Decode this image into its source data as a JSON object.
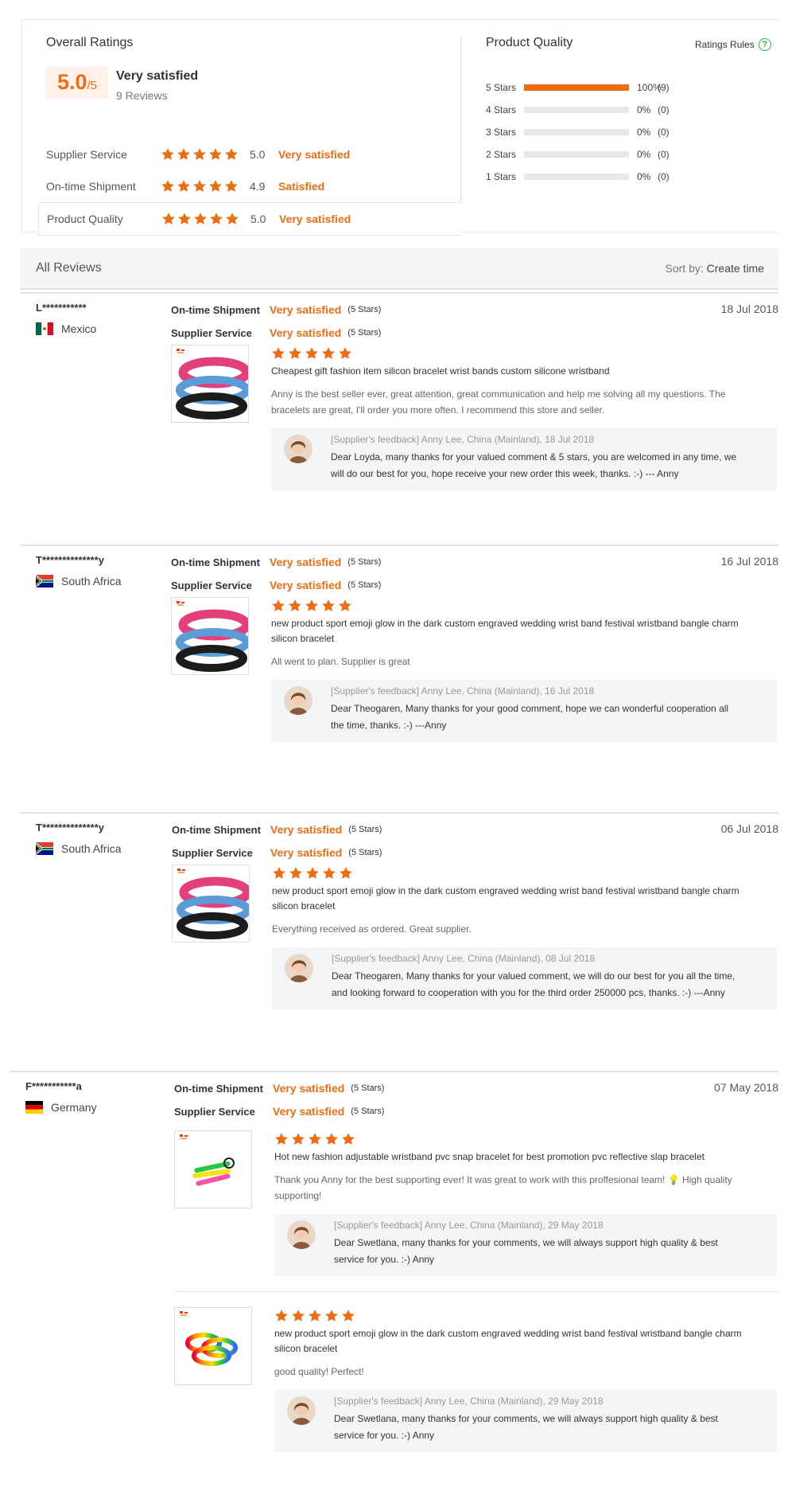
{
  "overall": {
    "title": "Overall Ratings",
    "score": "5.0",
    "score_max": "/5",
    "label": "Very satisfied",
    "count": "9 Reviews",
    "rows": [
      {
        "label": "Supplier Service",
        "value": "5.0",
        "word": "Very satisfied",
        "stars": 5
      },
      {
        "label": "On-time Shipment",
        "value": "4.9",
        "word": "Satisfied",
        "stars": 5
      },
      {
        "label": "Product Quality",
        "value": "5.0",
        "word": "Very satisfied",
        "stars": 5
      }
    ]
  },
  "product_quality": {
    "title": "Product Quality",
    "rules_label": "Ratings Rules",
    "rules_icon": "question-icon",
    "distribution": [
      {
        "label": "5 Stars",
        "percent": "100%",
        "count": "(9)",
        "fraction": 1.0
      },
      {
        "label": "4 Stars",
        "percent": "0%",
        "count": "(0)",
        "fraction": 0
      },
      {
        "label": "3 Stars",
        "percent": "0%",
        "count": "(0)",
        "fraction": 0
      },
      {
        "label": "2 Stars",
        "percent": "0%",
        "count": "(0)",
        "fraction": 0
      },
      {
        "label": "1 Stars",
        "percent": "0%",
        "count": "(0)",
        "fraction": 0
      }
    ]
  },
  "reviews_header": {
    "title": "All Reviews",
    "sort_prefix": "Sort by:",
    "sort_value": "Create time"
  },
  "metric_labels": {
    "shipment": "On-time Shipment",
    "service": "Supplier Service",
    "quality": "Product Quality"
  },
  "colors": {
    "accent": "#f06c13",
    "help": "#2bb34a"
  },
  "reviews": [
    {
      "user": "L***********",
      "country": "Mexico",
      "flag": "mexico",
      "date": "18 Jul 2018",
      "shipment": "Very satisfied",
      "shipment_stars": "(5 Stars)",
      "service": "Very satisfied",
      "service_stars": "(5 Stars)",
      "items": [
        {
          "stars": 5,
          "title_lines": [
            "Cheapest gift fashion item silicon bracelet wrist bands custom silicone wristband"
          ],
          "comment_lines": [
            "Anny is the best seller ever, great attention, great communication and help me solving all my questions. The",
            "bracelets are great, I'll order you more often. I recommend this store and seller."
          ],
          "feedback_header": "[Supplier's feedback] Anny Lee, China (Mainland), 18 Jul 2018",
          "feedback_lines": [
            "Dear Loyda, many thanks for your valued comment & 5 stars, you are welcomed in any time, we",
            "will do our best for you, hope receive your new order this week, thanks. :-) --- Anny"
          ]
        }
      ]
    },
    {
      "user": "T**************y",
      "country": "South Africa",
      "flag": "south-africa",
      "date": "16 Jul 2018",
      "shipment": "Very satisfied",
      "shipment_stars": "(5 Stars)",
      "service": "Very satisfied",
      "service_stars": "(5 Stars)",
      "items": [
        {
          "stars": 5,
          "title_lines": [
            "new product sport emoji glow in the dark custom engraved wedding wrist band festival wristband bangle charm",
            "silicon bracelet"
          ],
          "comment_lines": [
            "All went to plan. Supplier is great"
          ],
          "feedback_header": "[Supplier's feedback] Anny Lee, China (Mainland), 16 Jul 2018",
          "feedback_lines": [
            "Dear Theogaren, Many thanks for your good comment, hope we can wonderful cooperation all",
            "the time, thanks. :-) ---Anny"
          ]
        }
      ]
    },
    {
      "user": "T**************y",
      "country": "South Africa",
      "flag": "south-africa",
      "date": "06 Jul 2018",
      "shipment": "Very satisfied",
      "shipment_stars": "(5 Stars)",
      "service": "Very satisfied",
      "service_stars": "(5 Stars)",
      "items": [
        {
          "stars": 5,
          "title_lines": [
            "new product sport emoji glow in the dark custom engraved wedding wrist band festival wristband bangle charm",
            "silicon bracelet"
          ],
          "comment_lines": [
            "Everything received as ordered. Great supplier."
          ],
          "feedback_header": "[Supplier's feedback] Anny Lee, China (Mainland), 08 Jul 2018",
          "feedback_lines": [
            "Dear Theogaren, Many thanks for your valued comment, we will do our best for you all the time,",
            "and looking forward to cooperation with you for the third order 250000 pcs, thanks. :-) ---Anny"
          ]
        }
      ]
    },
    {
      "user": "F***********a",
      "country": "Germany",
      "flag": "germany",
      "date": "07 May 2018",
      "shipment": "Very satisfied",
      "shipment_stars": "(5 Stars)",
      "service": "Very satisfied",
      "service_stars": "(5 Stars)",
      "items": [
        {
          "stars": 5,
          "title_lines": [
            "Hot new fashion adjustable wristband pvc snap bracelet for best promotion pvc reflective slap bracelet"
          ],
          "comment_lines": [
            "Thank you Anny for the best supporting ever! It was great to work with this proffesional team! 💡 High quality",
            "supporting!"
          ],
          "feedback_header": "[Supplier's feedback] Anny Lee, China (Mainland), 29 May 2018",
          "feedback_lines": [
            "Dear Swetlana, many thanks for your comments, we will always support high quality & best",
            "service for you. :-) Anny"
          ]
        },
        {
          "stars": 5,
          "title_lines": [
            "new product sport emoji glow in the dark custom engraved wedding wrist band festival wristband bangle charm",
            "silicon bracelet"
          ],
          "comment_lines": [
            "good quality! Perfect!"
          ],
          "feedback_header": "[Supplier's feedback] Anny Lee, China (Mainland), 29 May 2018",
          "feedback_lines": [
            "Dear Swetlana, many thanks for your comments, we will always support high quality & best",
            "service for you. :-) Anny"
          ]
        }
      ]
    }
  ]
}
